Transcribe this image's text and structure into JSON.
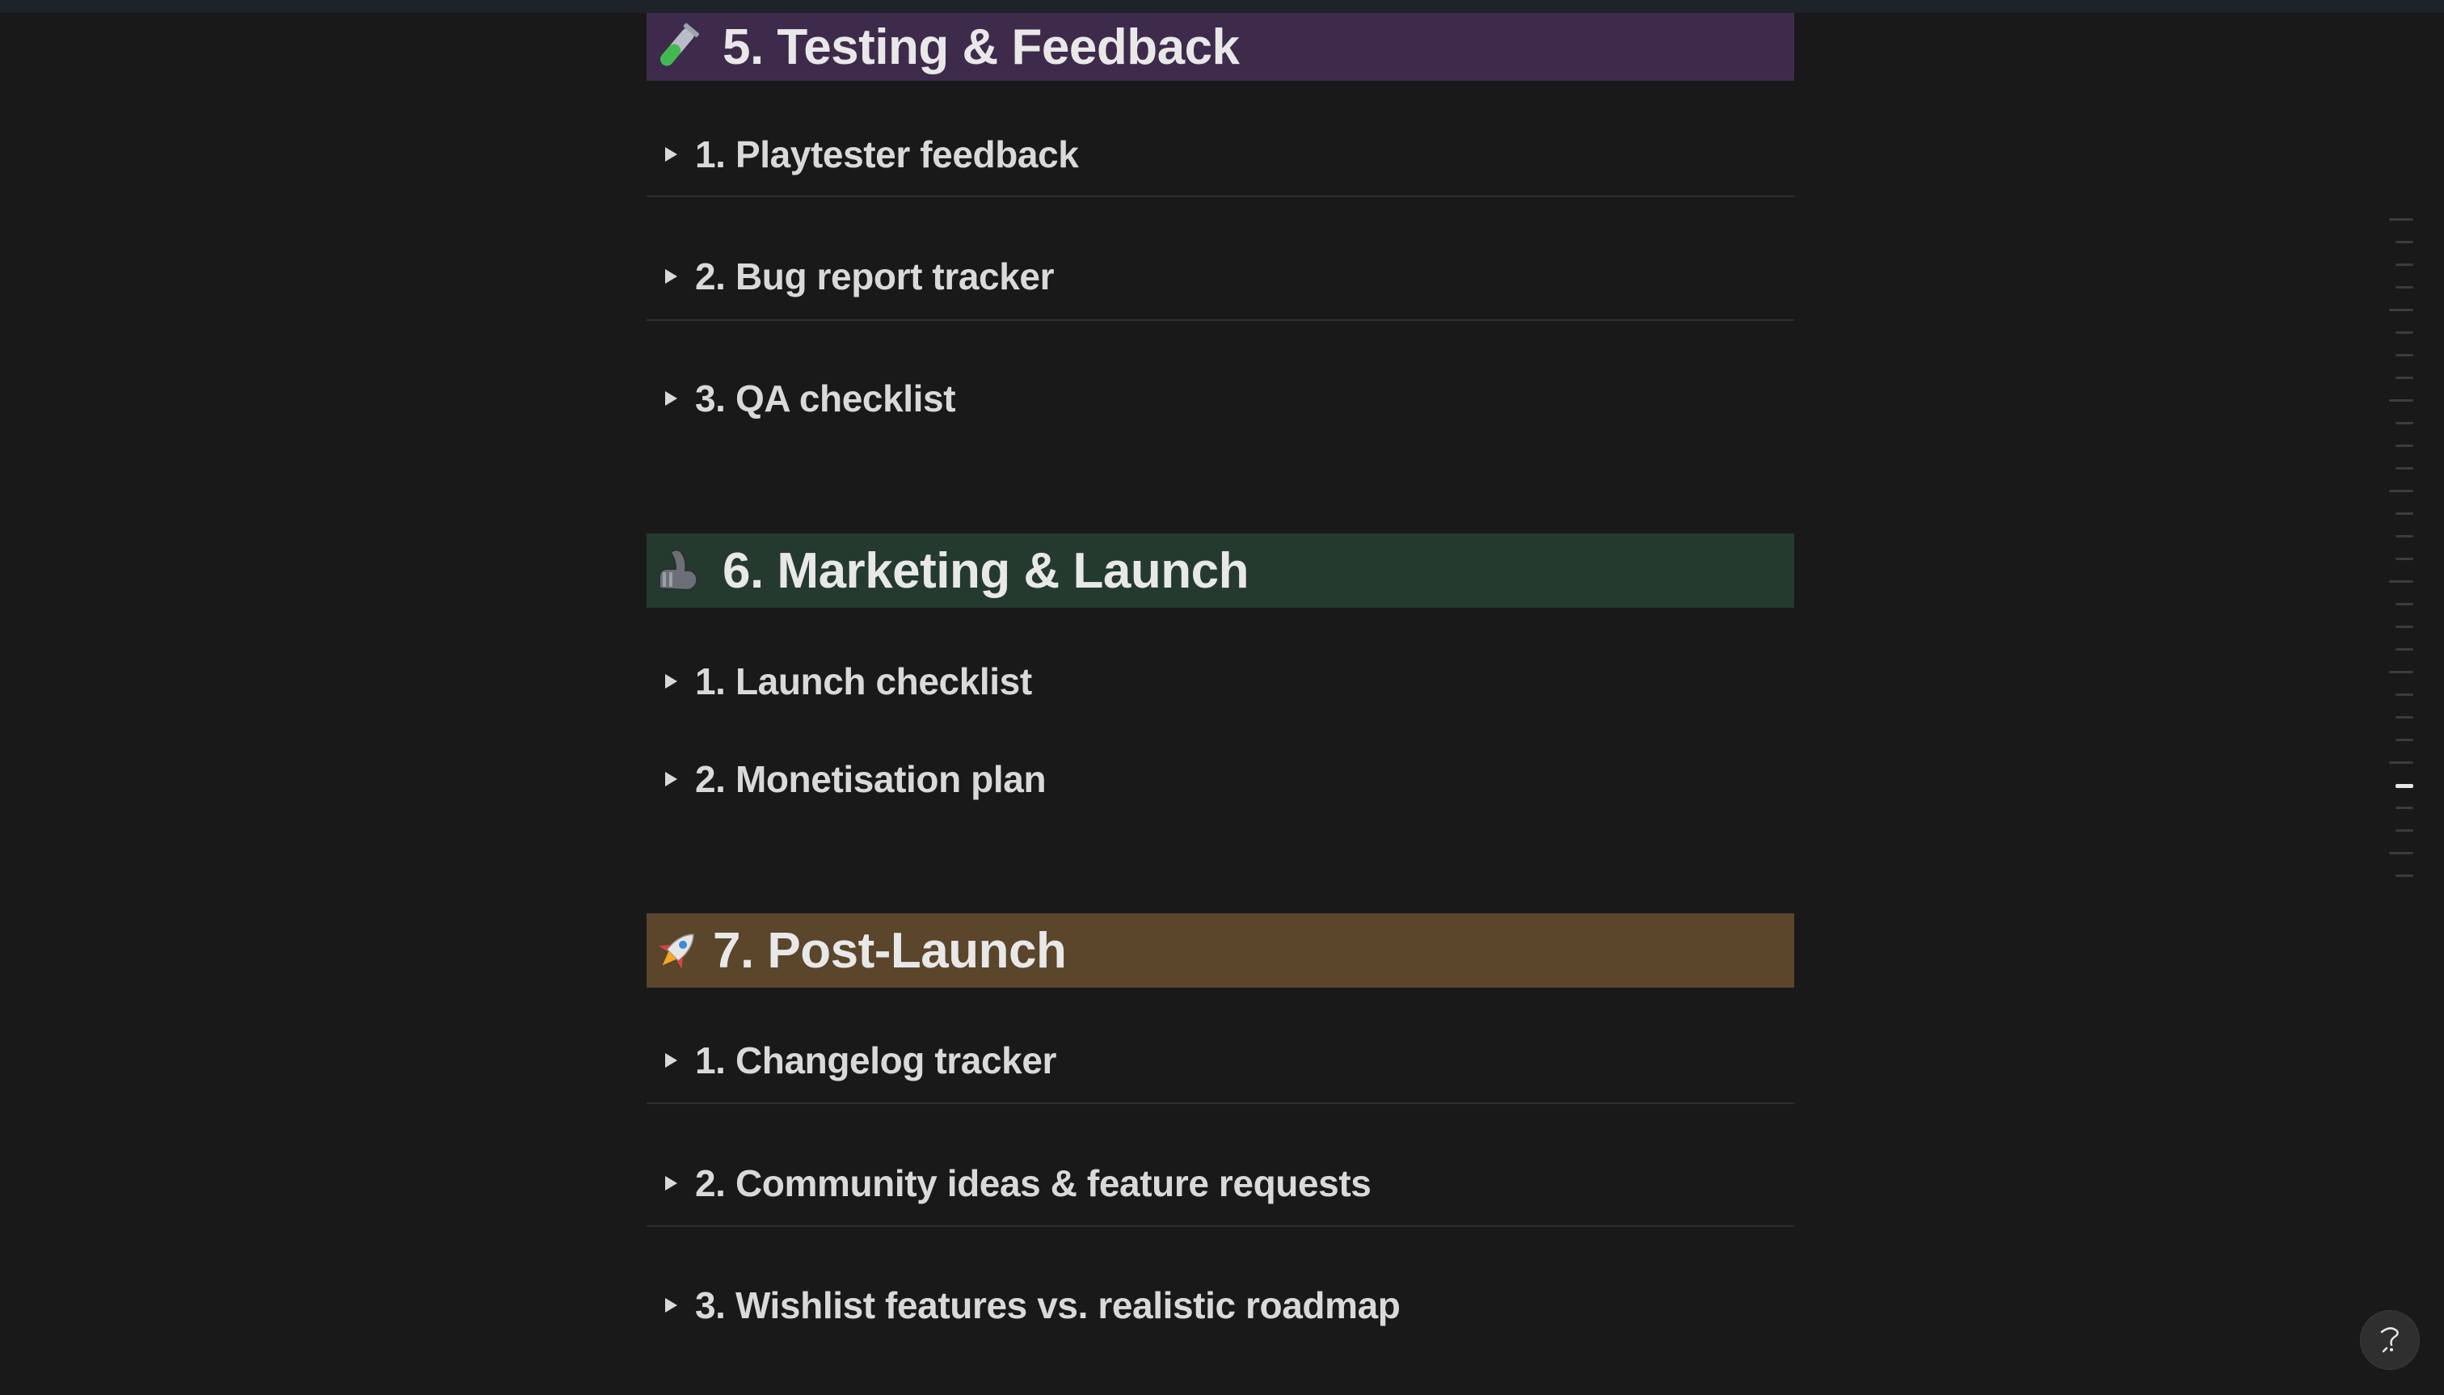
{
  "colors": {
    "background": "#191919",
    "heading_purple": "#3e2b4c",
    "heading_green": "#243a2f",
    "heading_brown": "#5b452b",
    "text": "#d9d9d9"
  },
  "sections": [
    {
      "icon": "test-tube-icon",
      "title": "5. Testing & Feedback",
      "items": [
        {
          "label": "1. Playtester feedback"
        },
        {
          "label": "2. Bug report tracker"
        },
        {
          "label": "3. QA checklist"
        }
      ]
    },
    {
      "icon": "flexed-biceps-icon",
      "title": "6. Marketing & Launch",
      "items": [
        {
          "label": "1. Launch checklist"
        },
        {
          "label": "2. Monetisation plan"
        }
      ]
    },
    {
      "icon": "rocket-icon",
      "title": "7.  Post-Launch",
      "items": [
        {
          "label": "1. Changelog tracker"
        },
        {
          "label": "2. Community ideas & feature requests"
        },
        {
          "label": "3. Wishlist features vs. realistic roadmap"
        }
      ]
    }
  ],
  "toc_active_index": 25,
  "help_button": {
    "icon": "help-icon"
  }
}
